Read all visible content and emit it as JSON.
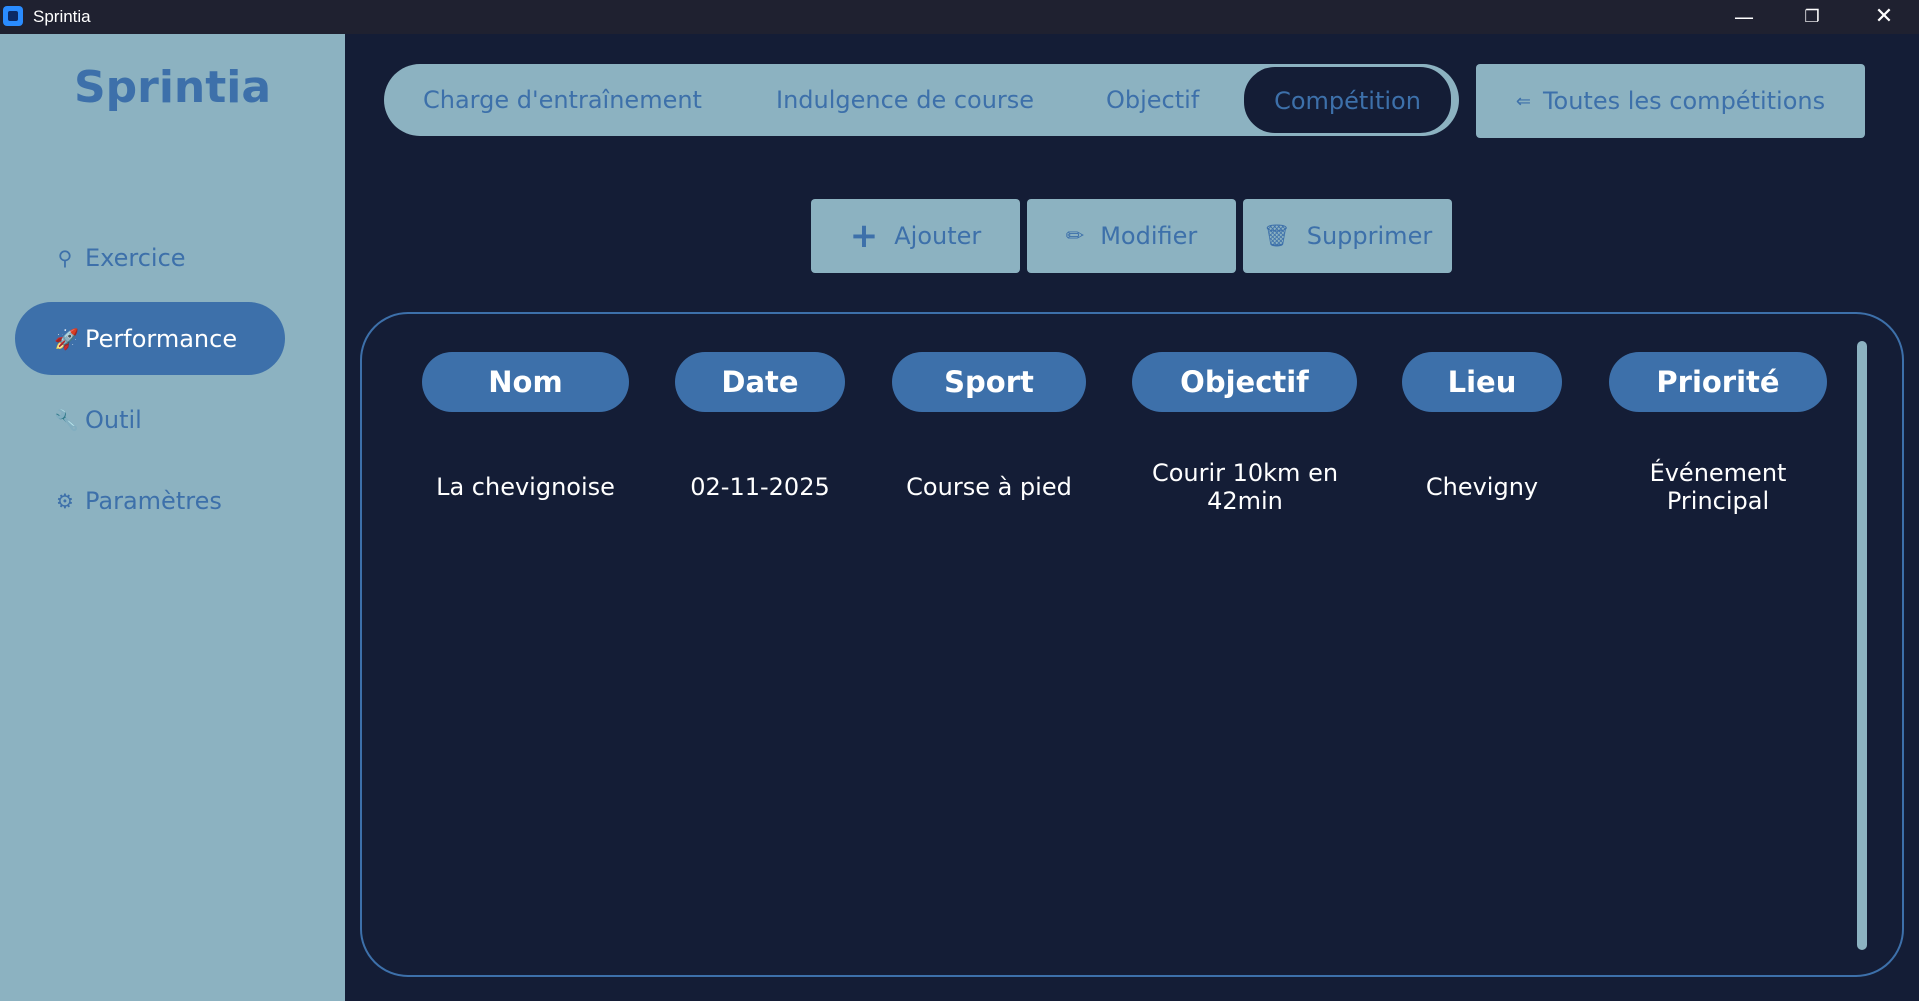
{
  "window": {
    "title": "Sprintia",
    "minimize": "—",
    "maximize": "❐",
    "close": "✕"
  },
  "sidebar": {
    "brand": "Sprintia",
    "items": [
      {
        "label": "Exercice",
        "icon": "⚲",
        "icon_name": "running-shoe-icon",
        "active": false
      },
      {
        "label": "Performance",
        "icon": "🚀",
        "icon_name": "rocket-icon",
        "active": true
      },
      {
        "label": "Outil",
        "icon": "🔧",
        "icon_name": "wrench-icon",
        "active": false
      },
      {
        "label": "Paramètres",
        "icon": "⚙",
        "icon_name": "gear-icon",
        "active": false
      }
    ]
  },
  "tabs": [
    {
      "label": "Charge d'entraînement",
      "active": false
    },
    {
      "label": "Indulgence de course",
      "active": false
    },
    {
      "label": "Objectif",
      "active": false
    },
    {
      "label": "Compétition",
      "active": true
    }
  ],
  "all_competitions": {
    "label": "Toutes les compétitions",
    "icon": "⇐",
    "icon_name": "back-arrow-icon"
  },
  "actions": {
    "add": {
      "label": "Ajouter",
      "icon": "+"
    },
    "edit": {
      "label": "Modifier",
      "icon": "✏"
    },
    "delete": {
      "label": "Supprimer",
      "icon": "🗑"
    }
  },
  "table": {
    "columns": [
      "Nom",
      "Date",
      "Sport",
      "Objectif",
      "Lieu",
      "Priorité"
    ],
    "rows": [
      [
        "La chevignoise",
        "02-11-2025",
        "Course à pied",
        "Courir 10km en 42min",
        "Chevigny",
        "Événement Principal"
      ]
    ]
  },
  "colors": {
    "background": "#141d36",
    "sidebar": "#8cb2c1",
    "accent": "#3d70aa",
    "text_light": "#ffffff"
  }
}
